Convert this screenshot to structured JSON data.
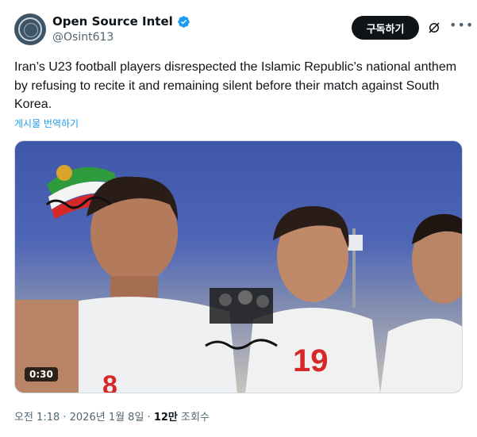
{
  "author": {
    "name": "Open Source Intel",
    "handle": "@Osint613"
  },
  "header": {
    "subscribe_label": "구독하기"
  },
  "tweet": {
    "text": "Iran’s U23 football players disrespected the Islamic Republic’s national anthem by refusing to recite it and remaining silent before their match against South Korea.",
    "translate_label": "게시물 번역하기"
  },
  "media": {
    "duration": "0:30",
    "jersey_number": "19",
    "jersey_number_left": "8"
  },
  "meta": {
    "time_date": "오전 1:18 · 2026년 1월 8일 · ",
    "views_count": "12만",
    "views_label": " 조회수"
  },
  "colors": {
    "accent": "#1d9bf0",
    "text_primary": "#0f1419",
    "text_secondary": "#536471",
    "button_dark": "#0f1419"
  },
  "icons": [
    "verified-badge-icon",
    "grok-icon",
    "more-icon",
    "play-duration-badge"
  ]
}
